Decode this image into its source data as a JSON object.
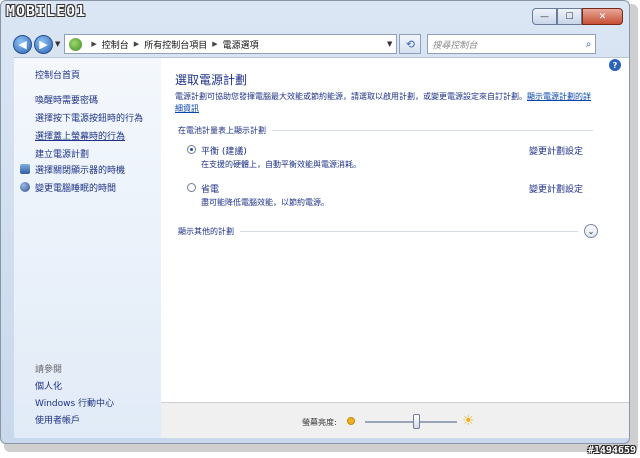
{
  "watermark": {
    "logo": "MOBILE01",
    "post_id": "#1494659"
  },
  "nav": {
    "breadcrumb": [
      "控制台",
      "所有控制台項目",
      "電源選項"
    ],
    "search_placeholder": "搜尋控制台"
  },
  "sidebar": {
    "home": "控制台首頁",
    "items": [
      {
        "label": "喚醒時需要密碼",
        "icon": ""
      },
      {
        "label": "選擇按下電源按鈕時的行為",
        "icon": ""
      },
      {
        "label": "選擇蓋上螢幕時的行為",
        "icon": ""
      },
      {
        "label": "建立電源計劃",
        "icon": ""
      },
      {
        "label": "選擇關閉顯示器的時機",
        "icon": "monitor-icon"
      },
      {
        "label": "變更電腦睡眠的時間",
        "icon": "moon-icon"
      }
    ],
    "see_also_title": "請參閱",
    "see_also": [
      "個人化",
      "Windows 行動中心",
      "使用者帳戶"
    ]
  },
  "main": {
    "title": "選取電源計劃",
    "description": "電源計劃可協助您發揮電腦最大效能或節約能源，請選取以啟用計劃，或變更電源設定來自訂計劃。",
    "description_link": "顯示電源計劃的詳細資訊",
    "section_label": "在電池計量表上顯示計劃",
    "plans": [
      {
        "name": "平衡 (建議)",
        "description": "在支援的硬體上，自動平衡效能與電源消耗。",
        "link": "變更計劃設定",
        "selected": true
      },
      {
        "name": "省電",
        "description": "盡可能降低電腦效能，以節約電源。",
        "link": "變更計劃設定",
        "selected": false
      }
    ],
    "more_plans": "顯示其他的計劃"
  },
  "footer": {
    "brightness_label": "螢幕亮度:",
    "brightness_level": 0.55
  }
}
